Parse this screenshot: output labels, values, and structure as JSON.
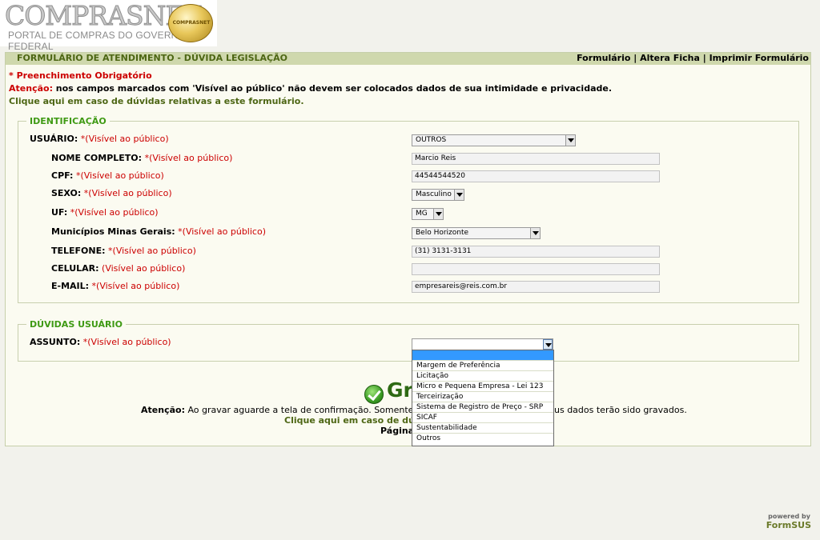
{
  "logo": {
    "word": "COMPRASNET",
    "subtitle": "PORTAL DE COMPRAS DO GOVERNO FEDERAL",
    "seal_text": "COMPRASNET"
  },
  "header": {
    "title": "FORMULÁRIO DE ATENDIMENTO - DÚVIDA LEGISLAÇÃO",
    "link_formulario": "Formulário",
    "link_altera_ficha": "Altera Ficha",
    "link_imprimir": "Imprimir Formulário",
    "sep": "|"
  },
  "notices": {
    "required": "* Preenchimento Obrigatório",
    "attention_label": "Atenção:",
    "attention_text": " nos campos marcados com 'Visível ao público' não devem ser colocados dados de sua intimidade e privacidade.",
    "help_link": "Clique aqui em caso de dúvidas relativas a este formulário."
  },
  "identificacao": {
    "legend": "IDENTIFICAÇÃO",
    "visible_tag": "*(Visível ao público)",
    "fields": {
      "usuario": {
        "label": "USUÁRIO:",
        "value": "OUTROS"
      },
      "nome": {
        "label": "NOME COMPLETO:",
        "value": "Marcio Reis"
      },
      "cpf": {
        "label": "CPF:",
        "value": "44544544520"
      },
      "sexo": {
        "label": "SEXO:",
        "value": "Masculino"
      },
      "uf": {
        "label": "UF:",
        "value": "MG"
      },
      "municipio": {
        "label": "Municípios Minas Gerais:",
        "value": "Belo Horizonte"
      },
      "telefone": {
        "label": "TELEFONE:",
        "value": "(31) 3131-3131"
      },
      "celular": {
        "label": "CELULAR:",
        "value": "",
        "visible_tag": "(Visível ao público)"
      },
      "email": {
        "label": "E-MAIL:",
        "value": "empresareis@reis.com.br"
      }
    }
  },
  "duvidas": {
    "legend": "DÚVIDAS USUÁRIO",
    "assunto_label": "ASSUNTO:",
    "assunto_value": "",
    "options": [
      "",
      "Margem de Preferência",
      "Licitação",
      "Micro e Pequena Empresa - Lei 123",
      "Terceirização",
      "Sistema de Registro de Preço - SRP",
      "SICAF",
      "Sustentabilidade",
      "Outros"
    ]
  },
  "footer": {
    "save_label_partial": "Gr",
    "attention_label": "Atenção:",
    "attention_left": " Ao gravar aguarde a tela de confirmação. Somente se apar",
    "attention_right": "us dados terão sido gravados.",
    "help_partial": "Clique aqui em caso de dúvida",
    "page_partial": "Página"
  },
  "powered": {
    "line1": "powered by",
    "line2": "FormSUS"
  }
}
